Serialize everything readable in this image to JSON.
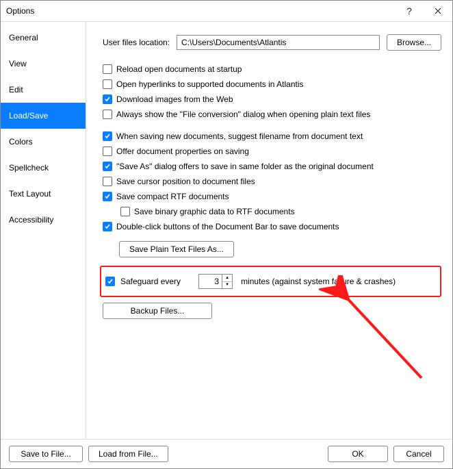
{
  "window": {
    "title": "Options"
  },
  "sidebar": {
    "tabs": [
      "General",
      "View",
      "Edit",
      "Load/Save",
      "Colors",
      "Spellcheck",
      "Text Layout",
      "Accessibility"
    ],
    "active_index": 3
  },
  "panel": {
    "location_label": "User files location:",
    "location_value": "C:\\Users\\Documents\\Atlantis",
    "browse_btn": "Browse...",
    "group1": [
      {
        "checked": false,
        "text": "Reload open documents at startup"
      },
      {
        "checked": false,
        "text": "Open hyperlinks to supported documents in Atlantis"
      },
      {
        "checked": true,
        "text": "Download images from the Web"
      },
      {
        "checked": false,
        "text": "Always show the \"File conversion\" dialog when opening plain text files"
      }
    ],
    "group2": [
      {
        "checked": true,
        "text": "When saving new documents, suggest filename from document text"
      },
      {
        "checked": false,
        "text": "Offer document properties on saving"
      },
      {
        "checked": true,
        "text": "\"Save As\" dialog offers to save in same folder as the original document"
      },
      {
        "checked": false,
        "text": "Save cursor position to document files"
      },
      {
        "checked": true,
        "text": "Save compact RTF documents"
      },
      {
        "checked": false,
        "text": "Save binary graphic data to RTF documents",
        "indent": true
      },
      {
        "checked": true,
        "text": "Double-click buttons of the Document Bar to save documents"
      }
    ],
    "save_plain_btn": "Save Plain Text Files As...",
    "safeguard": {
      "checked": true,
      "prefix": "Safeguard every",
      "value": "3",
      "suffix": "minutes (against system failure & crashes)"
    },
    "backup_btn": "Backup Files..."
  },
  "footer": {
    "save_to_file": "Save to File...",
    "load_from_file": "Load from File...",
    "ok": "OK",
    "cancel": "Cancel"
  }
}
